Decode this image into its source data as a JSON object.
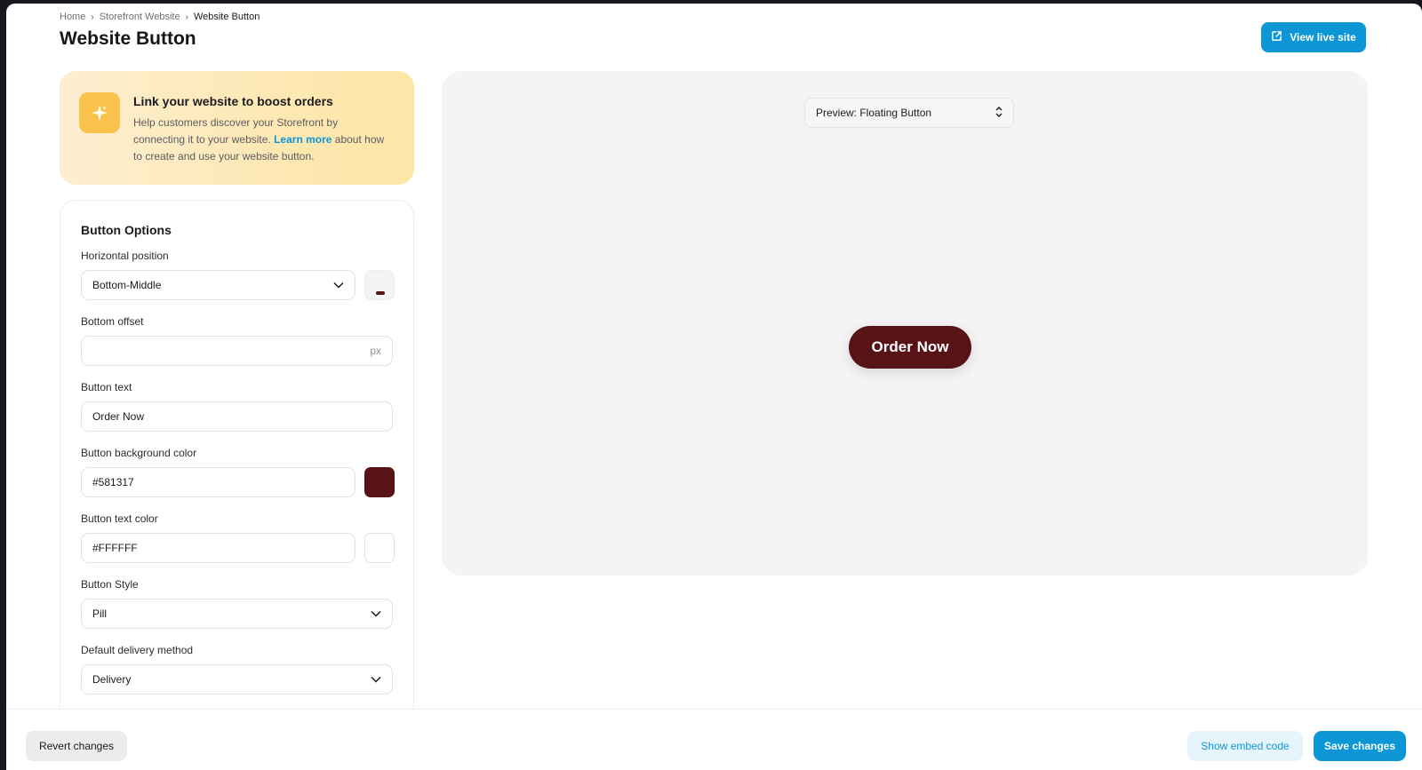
{
  "breadcrumb": {
    "home": "Home",
    "parent": "Storefront Website",
    "current": "Website Button"
  },
  "page": {
    "title": "Website Button"
  },
  "header": {
    "live_site_label": "View live site"
  },
  "promo": {
    "title": "Link your website to boost orders",
    "body_before": "Help customers discover your Storefront by connecting it to your website. ",
    "link": "Learn more",
    "body_after": " about how to create and use your website button.",
    "icon": "sparkle-icon"
  },
  "options": {
    "title": "Button Options",
    "horizontal_position": {
      "label": "Horizontal position",
      "value": "Bottom-Middle"
    },
    "bottom_offset": {
      "label": "Bottom offset",
      "value": "",
      "unit": "px"
    },
    "button_text": {
      "label": "Button text",
      "value": "Order Now"
    },
    "bg_color": {
      "label": "Button background color",
      "value": "#581317"
    },
    "text_color": {
      "label": "Button text color",
      "value": "#FFFFFF"
    },
    "button_style": {
      "label": "Button Style",
      "value": "Pill"
    },
    "delivery": {
      "label": "Default delivery method",
      "value": "Delivery"
    }
  },
  "preview": {
    "select_label": "Preview: Floating Button",
    "button_label": "Order Now"
  },
  "footer": {
    "revert": "Revert changes",
    "embed": "Show embed code",
    "save": "Save changes"
  },
  "colors": {
    "accent": "#0d96d6",
    "button_bg": "#581317",
    "button_text": "#FFFFFF",
    "badge": "#fbc24b"
  }
}
